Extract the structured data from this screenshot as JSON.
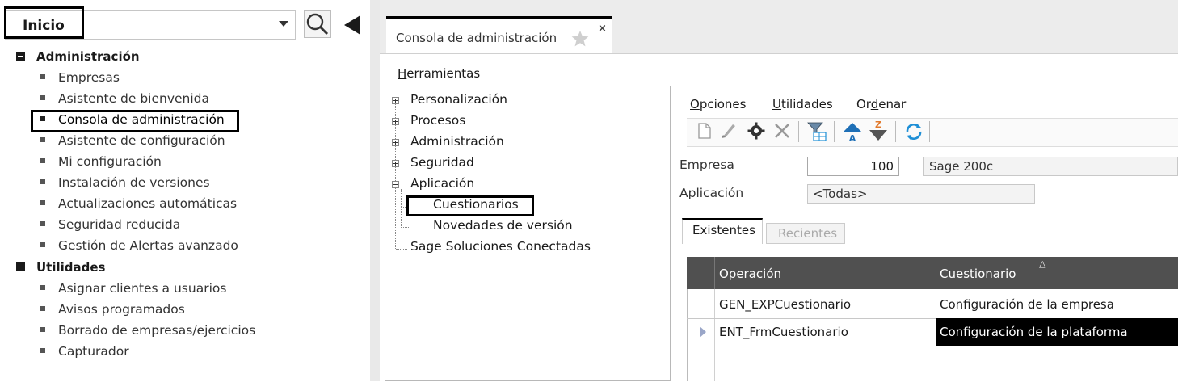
{
  "nav": {
    "combo_value": "Inicio",
    "groups": [
      {
        "label": "Administración",
        "items": [
          "Empresas",
          "Asistente de bienvenida",
          "Consola de administración",
          "Asistente de configuración",
          "Mi configuración",
          "Instalación de versiones",
          "Actualizaciones automáticas",
          "Seguridad reducida",
          "Gestión de Alertas avanzado"
        ]
      },
      {
        "label": "Utilidades",
        "items": [
          "Asignar clientes a usuarios",
          "Avisos programados",
          "Borrado de empresas/ejercicios",
          "Capturador"
        ]
      }
    ],
    "selected_item": "Consola de administración"
  },
  "tab": {
    "title": "Consola de administración",
    "close": "×"
  },
  "menubar": {
    "herramientas_mnemonic": "H",
    "herramientas_rest": "erramientas"
  },
  "tree": {
    "personalizacion": "Personalización",
    "procesos": "Procesos",
    "administracion": "Administración",
    "seguridad": "Seguridad",
    "aplicacion": "Aplicación",
    "cuestionarios": "Cuestionarios",
    "novedades": "Novedades de versión",
    "sage_conectadas": "Sage Soluciones Conectadas"
  },
  "panel_menu": {
    "opciones_m": "O",
    "opciones_r": "pciones",
    "utilidades_m": "U",
    "utilidades_r": "tilidades",
    "ordenar_a": "Or",
    "ordenar_m": "d",
    "ordenar_r": "enar"
  },
  "form": {
    "empresa_label": "Empresa",
    "empresa_code": "100",
    "empresa_name": "Sage 200c",
    "aplicacion_label": "Aplicación",
    "aplicacion_value": "<Todas>"
  },
  "subtabs": {
    "existentes": "Existentes",
    "recientes": "Recientes"
  },
  "grid": {
    "columns": [
      "Operación",
      "Cuestionario"
    ],
    "sort_indicator": "△",
    "rows": [
      {
        "operacion": "GEN_EXPCuestionario",
        "cuestionario": "Configuración de la empresa"
      },
      {
        "operacion": "ENT_FrmCuestionario",
        "cuestionario": "Configuración de la plataforma"
      }
    ]
  },
  "colors": {
    "highlight_border": "#000000",
    "grid_header": "#505050",
    "accent_blue": "#1e8fd6",
    "accent_orange": "#e2792b"
  }
}
